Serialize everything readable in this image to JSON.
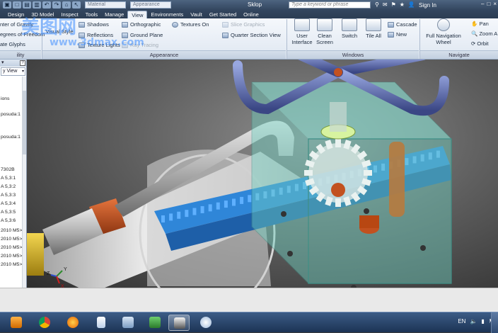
{
  "title_bar": {
    "doc_title": "Sklop",
    "material_dropdown": "Material",
    "appearance_dropdown": "Appearance",
    "search_placeholder": "Type a keyword or phrase",
    "sign_in": "Sign In",
    "window_buttons": [
      "–",
      "□",
      "×"
    ]
  },
  "tabs": [
    {
      "label": "Design"
    },
    {
      "label": "3D Model"
    },
    {
      "label": "Inspect"
    },
    {
      "label": "Tools"
    },
    {
      "label": "Manage"
    },
    {
      "label": "View",
      "active": true
    },
    {
      "label": "Environments"
    },
    {
      "label": "Vault"
    },
    {
      "label": "Get Started"
    },
    {
      "label": "Online"
    }
  ],
  "ribbon": {
    "visibility": {
      "center_gravity": "nter of Gravity",
      "degrees_freedom": "egrees of Freedom",
      "glyphs": "ate Glyphs",
      "panel": "ility"
    },
    "appearance": {
      "visual_style": "Visual Style",
      "shadows": "Shadows",
      "reflections": "Reflections",
      "texture_lights": "Texture Lights",
      "orthographic": "Orthographic",
      "ground_plane": "Ground Plane",
      "ray_tracing": "Ray Tracing",
      "textures_on": "Textures On",
      "slice_graphics": "Slice Graphics",
      "quarter_section": "Quarter Section View",
      "panel": "Appearance"
    },
    "windows": {
      "user_interface": [
        "User",
        "Interface"
      ],
      "clean_screen": [
        "Clean",
        "Screen"
      ],
      "switch": "Switch",
      "tile_all": "Tile All",
      "cascade": "Cascade",
      "new": "New",
      "panel": "Windows"
    },
    "navigate": {
      "full_nav_wheel": [
        "Full Navigation",
        "Wheel"
      ],
      "pan": "Pan",
      "zoom_all": "Zoom A",
      "orbit": "Orbit",
      "panel": "Navigate"
    }
  },
  "browser": {
    "view_label": "y View",
    "items": [
      "ions",
      "posuda:1",
      "posuda:1",
      "7302B",
      "A 5,3:1",
      "A 5,3:2",
      "A 5,3:3",
      "A 5,3:4",
      "A 5,3:5",
      "A 5,3:6",
      "2010 M5>",
      "2010 M5>",
      "2010 M5>",
      "2010 M5>",
      "2010 M5>"
    ]
  },
  "axis_triad": {
    "x": "X",
    "y": "Y",
    "z": "Z"
  },
  "watermark": {
    "cn": "美图网",
    "en": "www.3dmax.com"
  },
  "taskbar": {
    "language": "EN",
    "icons": [
      "media-player-icon",
      "chrome-icon",
      "firefox-icon",
      "document-icon",
      "calculator-icon",
      "monitor-icon",
      "inventor-icon",
      "paint-icon"
    ]
  },
  "colors": {
    "housing": "#6fd0c0",
    "rack": "#2f86d8",
    "pipe": "#a9a9a9",
    "rubber": "#c2511f",
    "handwheel": "#5e6fb0",
    "brass": "#d9b221"
  }
}
